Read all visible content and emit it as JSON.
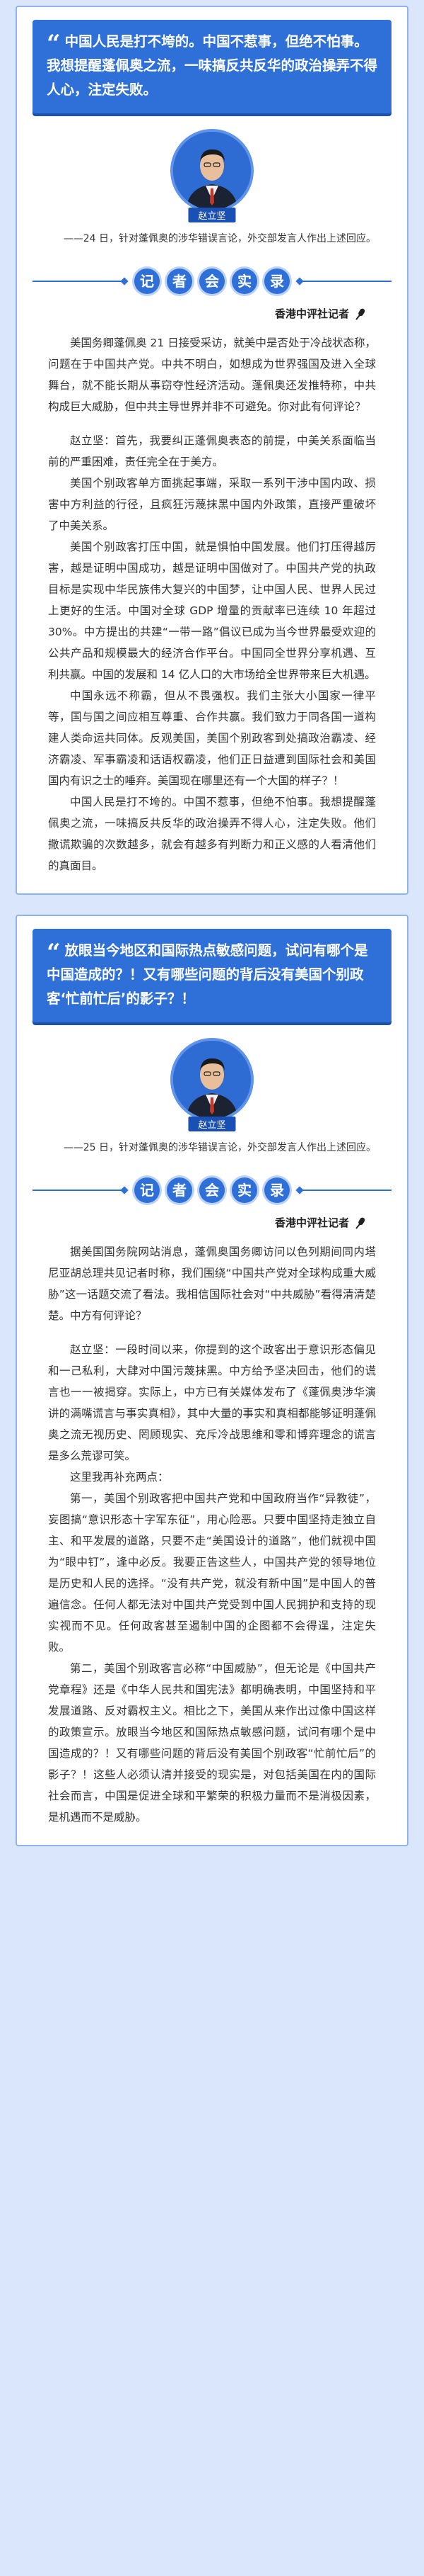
{
  "card1": {
    "quote": "中国人民是打不垮的。中国不惹事，但绝不怕事。我想提醒蓬佩奥之流，一味搞反共反华的政治操弄不得人心，注定失败。",
    "name_tag": "赵立坚",
    "caption": "——24 日，针对蓬佩奥的涉华错误言论，外交部发言人作出上述回应。",
    "section_chars": [
      "记",
      "者",
      "会",
      "实",
      "录"
    ],
    "reporter": "香港中评社记者",
    "paragraphs": [
      "美国务卿蓬佩奥 21 日接受采访，就美中是否处于冷战状态称，问题在于中国共产党。中共不明白，如想成为世界强国及进入全球舞台，就不能长期从事窃夺性经济活动。蓬佩奥还发推特称，中共构成巨大威胁，但中共主导世界并非不可避免。你对此有何评论？",
      "赵立坚：首先，我要纠正蓬佩奥表态的前提，中美关系面临当前的严重困难，责任完全在于美方。",
      "美国个别政客单方面挑起事端，采取一系列干涉中国内政、损害中方利益的行径，且疯狂污蔑抹黑中国内外政策，直接严重破坏了中美关系。",
      "美国个别政客打压中国，就是惧怕中国发展。他们打压得越厉害，越是证明中国成功，越是证明中国做对了。中国共产党的执政目标是实现中华民族伟大复兴的中国梦，让中国人民、世界人民过上更好的生活。中国对全球 GDP 增量的贡献率已连续 10 年超过 30%。中方提出的共建“一带一路”倡议已成为当今世界最受欢迎的公共产品和规模最大的经济合作平台。中国同全世界分享机遇、互利共赢。中国的发展和 14 亿人口的大市场给全世界带来巨大机遇。",
      "中国永远不称霸，但从不畏强权。我们主张大小国家一律平等，国与国之间应相互尊重、合作共赢。我们致力于同各国一道构建人类命运共同体。反观美国，美国个别政客到处搞政治霸凌、经济霸凌、军事霸凌和话语权霸凌，他们正日益遭到国际社会和美国国内有识之士的唾弃。美国现在哪里还有一个大国的样子？！",
      "中国人民是打不垮的。中国不惹事，但绝不怕事。我想提醒蓬佩奥之流，一味搞反共反华的政治操弄不得人心，注定失败。他们撒谎欺骗的次数越多，就会有越多有判断力和正义感的人看清他们的真面目。"
    ]
  },
  "card2": {
    "quote": "放眼当今地区和国际热点敏感问题，试问有哪个是中国造成的？！又有哪些问题的背后没有美国个别政客‘忙前忙后’的影子？！",
    "name_tag": "赵立坚",
    "caption": "——25 日，针对蓬佩奥的涉华错误言论，外交部发言人作出上述回应。",
    "section_chars": [
      "记",
      "者",
      "会",
      "实",
      "录"
    ],
    "reporter": "香港中评社记者",
    "paragraphs": [
      "据美国国务院网站消息，蓬佩奥国务卿访问以色列期间同内塔尼亚胡总理共见记者时称，我们围绕“中国共产党对全球构成重大威胁”这一话题交流了看法。我相信国际社会对“中共威胁”看得清清楚楚。中方有何评论？",
      "赵立坚：一段时间以来，你提到的这个政客出于意识形态偏见和一己私利，大肆对中国污蔑抹黑。中方给予坚决回击，他们的谎言也一一被揭穿。实际上，中方已有关媒体发布了《蓬佩奥涉华演讲的满嘴谎言与事实真相》，其中大量的事实和真相都能够证明蓬佩奥之流无视历史、罔顾现实、充斥冷战思维和零和博弈理念的谎言是多么荒谬可笑。",
      "这里我再补充两点：",
      "第一，美国个别政客把中国共产党和中国政府当作“异教徒”，妄图搞“意识形态十字军东征”，用心险恶。只要中国坚持走独立自主、和平发展的道路，只要不走“美国设计的道路”，他们就视中国为“眼中钉”，逢中必反。我要正告这些人，中国共产党的领导地位是历史和人民的选择。“没有共产党，就没有新中国”是中国人的普遍信念。任何人都无法对中国共产党受到中国人民拥护和支持的现实视而不见。任何政客甚至遏制中国的企图都不会得逞，注定失败。",
      "第二，美国个别政客言必称“中国威胁”，但无论是《中国共产党章程》还是《中华人民共和国宪法》都明确表明，中国坚持和平发展道路、反对霸权主义。相比之下，美国从来作出过像中国这样的政策宣示。放眼当今地区和国际热点敏感问题，试问有哪个是中国造成的？！又有哪些问题的背后没有美国个别政客“忙前忙后”的影子？！这些人必须认清并接受的现实是，对包括美国在内的国际社会而言，中国是促进全球和平繁荣的积极力量而不是消极因素，是机遇而不是威胁。"
    ]
  }
}
